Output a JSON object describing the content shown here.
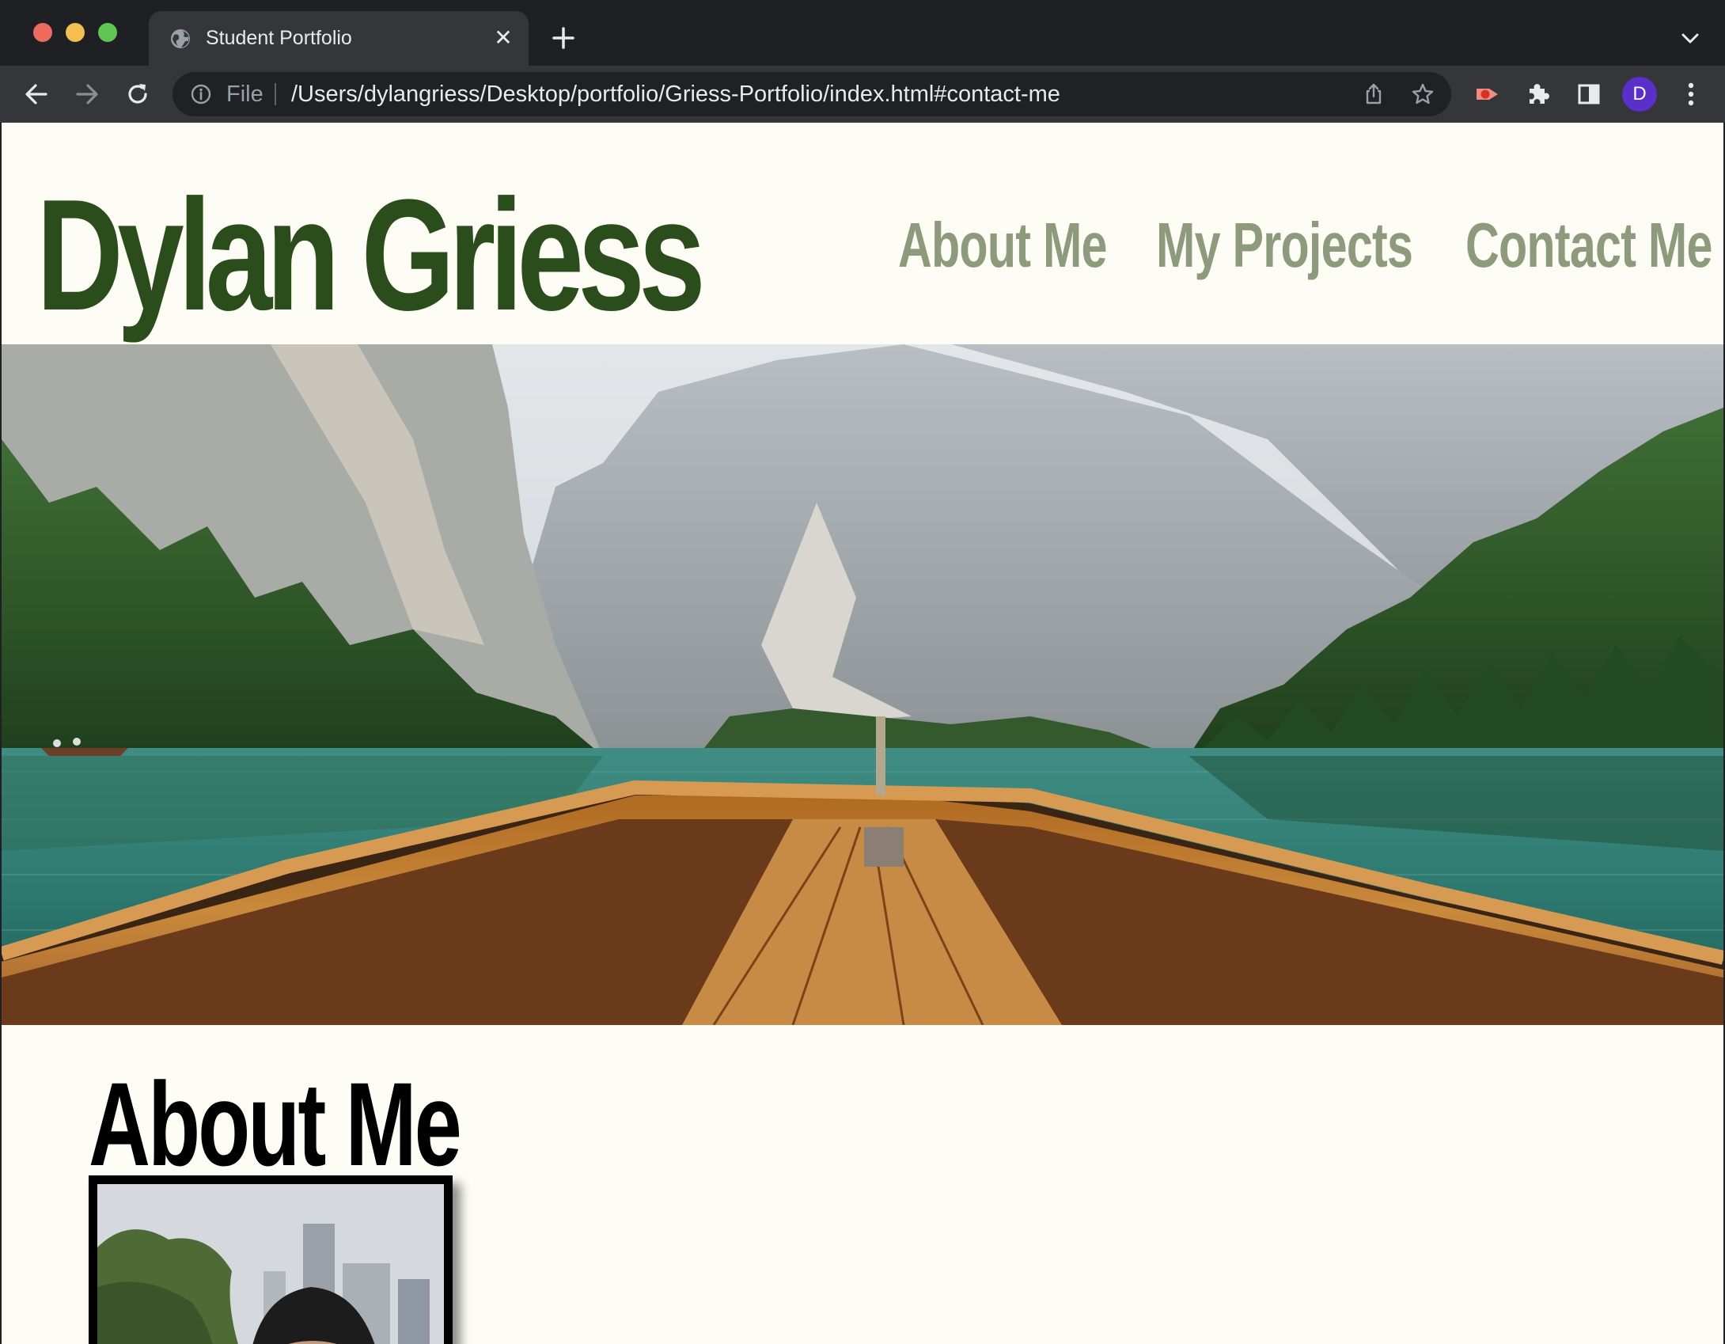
{
  "browser": {
    "tab": {
      "title": "Student Portfolio"
    },
    "address": {
      "scheme_label": "File",
      "url": "/Users/dylangriess/Desktop/portfolio/Griess-Portfolio/index.html#contact-me"
    },
    "profile_initial": "D"
  },
  "page": {
    "site_name": "Dylan Griess",
    "nav": [
      {
        "label": "About Me"
      },
      {
        "label": "My Projects"
      },
      {
        "label": "Contact Me"
      }
    ],
    "sections": {
      "about": {
        "title": "About Me"
      }
    }
  },
  "colors": {
    "page_background": "#fdfdf6",
    "site_name": "#2a4d1b",
    "nav_link": "#8d9a7b",
    "section_title": "#000000"
  }
}
